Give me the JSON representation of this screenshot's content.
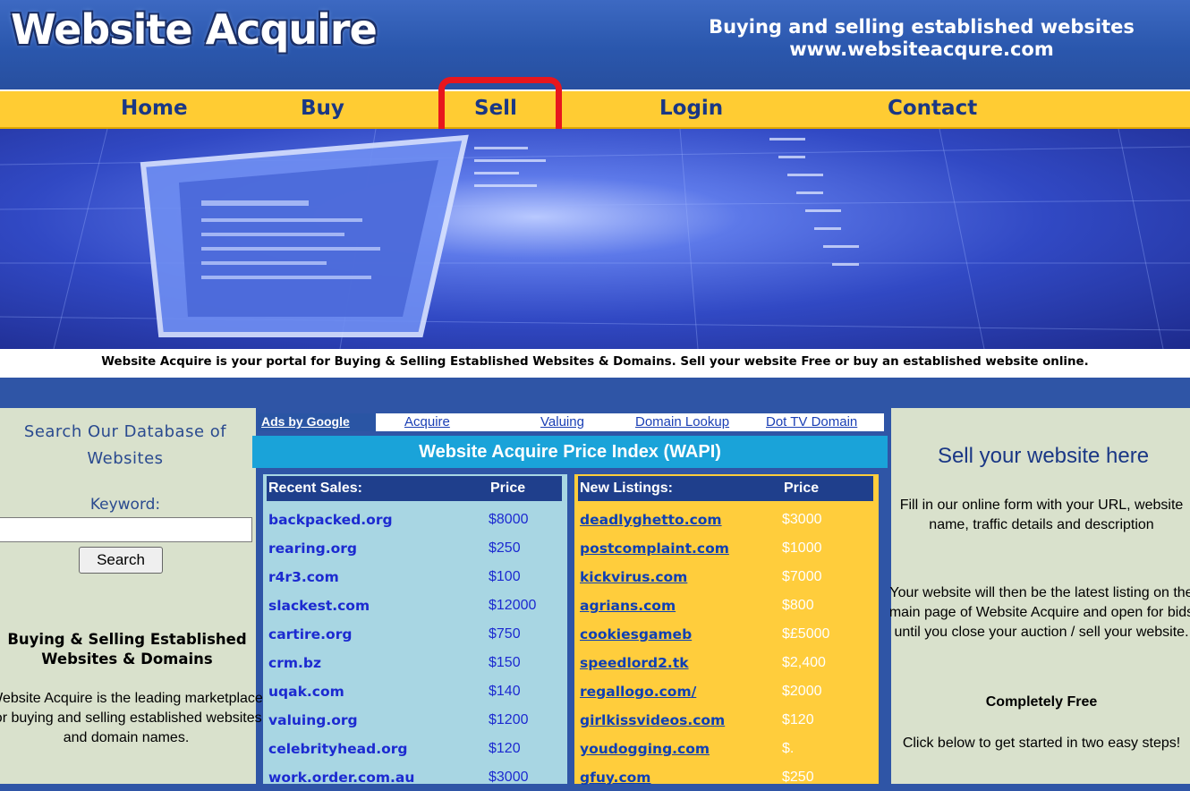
{
  "header": {
    "logo_text": "Website Acquire",
    "tagline": "Buying and selling established websites",
    "url": "www.websiteacqure.com"
  },
  "nav": {
    "items": [
      "Home",
      "Buy",
      "Sell",
      "Login",
      "Contact"
    ],
    "highlighted": "Sell",
    "colors": {
      "bar": "#ffcc33",
      "text": "#1a3785",
      "highlight": "#e8161d"
    }
  },
  "strapline": "Website Acquire is your portal for Buying & Selling Established Websites & Domains. Sell your website Free or buy an established website online.",
  "left": {
    "search_title": "Search Our Database of Websites",
    "keyword_label": "Keyword:",
    "search_value": "",
    "search_button": "Search",
    "heading": "Buying & Selling Established Websites & Domains",
    "body": "Website Acquire is the leading marketplace for buying and selling established websites and domain names."
  },
  "ads": {
    "label": "Ads by Google",
    "links": [
      "Acquire",
      "Valuing",
      "Domain Lookup",
      "Dot TV Domain"
    ]
  },
  "wapi": {
    "title": "Website Acquire Price Index (WAPI)",
    "sales_header": [
      "Recent Sales:",
      "Price"
    ],
    "sales": [
      [
        "backpacked.org",
        "$8000"
      ],
      [
        "rearing.org",
        "$250"
      ],
      [
        "r4r3.com",
        "$100"
      ],
      [
        "slackest.com",
        "$12000"
      ],
      [
        "cartire.org",
        "$750"
      ],
      [
        "crm.bz",
        "$150"
      ],
      [
        "uqak.com",
        "$140"
      ],
      [
        "valuing.org",
        "$1200"
      ],
      [
        "celebrityhead.org",
        "$120"
      ],
      [
        "work.order.com.au",
        "$3000"
      ]
    ],
    "listings_header": [
      "New Listings:",
      "Price"
    ],
    "listings": [
      [
        "deadlyghetto.com",
        "$3000"
      ],
      [
        "postcomplaint.com",
        "$1000"
      ],
      [
        "kickvirus.com",
        "$7000"
      ],
      [
        "agrians.com",
        "$800"
      ],
      [
        "cookiesgameb",
        "$£5000"
      ],
      [
        "speedlord2.tk",
        "$2,400"
      ],
      [
        "regallogo.com/",
        "$2000"
      ],
      [
        "girlkissvideos.com",
        "$120"
      ],
      [
        "youdogging.com",
        "$."
      ],
      [
        "gfuy.com",
        "$250"
      ]
    ]
  },
  "right": {
    "title": "Sell your website here",
    "p1": "Fill in our online form with your URL, website name, traffic details and description",
    "p2": "Your website will then be the latest listing on the main page of Website Acquire and open for bids until you close your auction / sell your website.",
    "free": "Completely Free",
    "p3": "Click below to get started in two easy steps!"
  }
}
